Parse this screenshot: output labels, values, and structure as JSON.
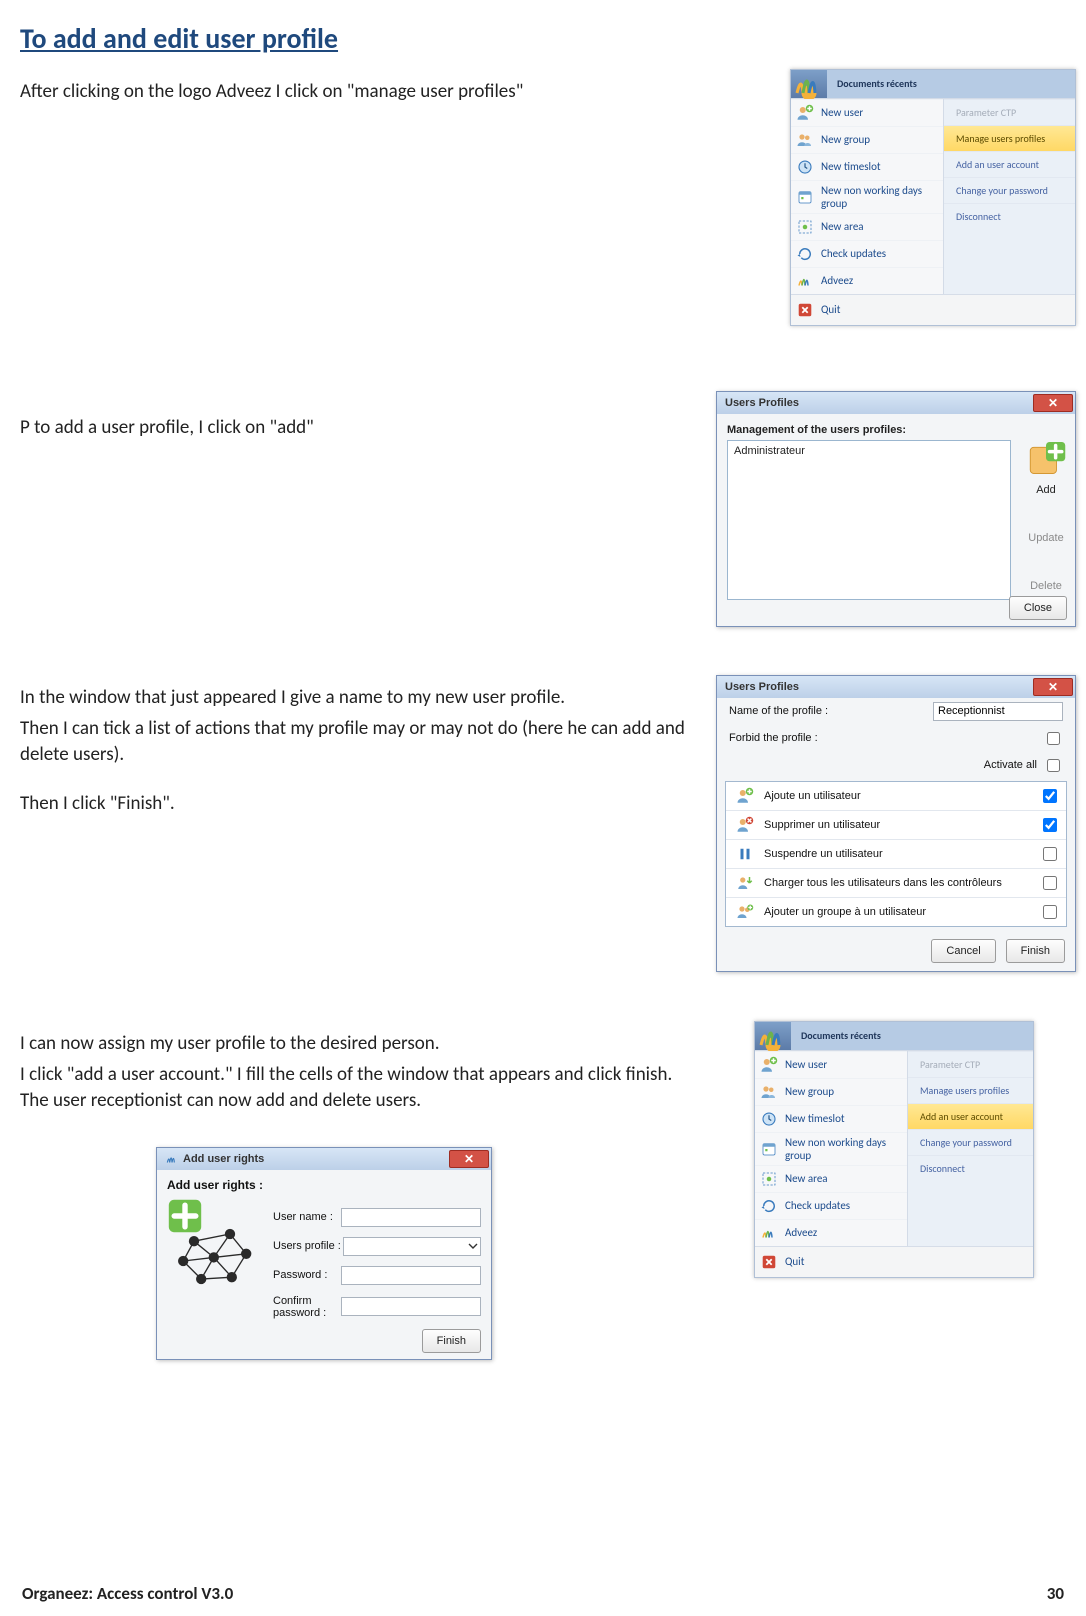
{
  "heading": "To add and edit user profile",
  "p1": "After clicking on the logo Adveez I click on \"manage user profiles\"",
  "p2": "P to add a user profile, I click on \"add\"",
  "p3": "In the window that just appeared I give a name to my new user profile.",
  "p4": "Then I can tick a list of actions that my profile may or may not do (here he can add and delete users).",
  "p5": "Then I click \"Finish\".",
  "p6": "I can now assign my user profile to the desired person.",
  "p7": "I click \"add a user account.\" I fill the cells of the window that appears and click finish. The user receptionist can now add and delete users.",
  "menu": {
    "doc_recent": "Documents récents",
    "items": [
      {
        "label": "New user",
        "icon": "user-plus"
      },
      {
        "label": "New group",
        "icon": "group"
      },
      {
        "label": "New timeslot",
        "icon": "clock"
      },
      {
        "label": "New non working days group",
        "icon": "calendar"
      },
      {
        "label": "New area",
        "icon": "area"
      },
      {
        "label": "Check updates",
        "icon": "refresh"
      },
      {
        "label": "Adveez",
        "icon": "bars"
      }
    ],
    "sub": [
      {
        "label": "Parameter CTP",
        "disabled": true,
        "hl": false
      },
      {
        "label": "Manage users profiles",
        "disabled": false,
        "hl": true
      },
      {
        "label": "Add an user account",
        "disabled": false,
        "hl": false
      },
      {
        "label": "Change your password",
        "disabled": false,
        "hl": false
      },
      {
        "label": "Disconnect",
        "disabled": false,
        "hl": false
      }
    ],
    "quit": "Quit"
  },
  "menu2": {
    "doc_recent": "Documents récents",
    "items": [
      {
        "label": "New user",
        "icon": "user-plus"
      },
      {
        "label": "New group",
        "icon": "group"
      },
      {
        "label": "New timeslot",
        "icon": "clock"
      },
      {
        "label": "New non working days group",
        "icon": "calendar"
      },
      {
        "label": "New area",
        "icon": "area"
      },
      {
        "label": "Check updates",
        "icon": "refresh"
      },
      {
        "label": "Adveez",
        "icon": "bars"
      }
    ],
    "sub": [
      {
        "label": "Parameter CTP",
        "disabled": true,
        "hl": false
      },
      {
        "label": "Manage users profiles",
        "disabled": false,
        "hl": false
      },
      {
        "label": "Add an user account",
        "disabled": false,
        "hl": true
      },
      {
        "label": "Change your password",
        "disabled": false,
        "hl": false
      },
      {
        "label": "Disconnect",
        "disabled": false,
        "hl": false
      }
    ],
    "quit": "Quit"
  },
  "up_window": {
    "title": "Users Profiles",
    "header": "Management of the users profiles:",
    "row0": "Administrateur",
    "add": "Add",
    "update": "Update",
    "delete": "Delete",
    "close": "Close"
  },
  "pe_window": {
    "title": "Users Profiles",
    "name_label": "Name of the profile :",
    "name_value": "Receptionnist",
    "forbid_label": "Forbid the profile :",
    "activate_all": "Activate all",
    "items": [
      {
        "label": "Ajoute un utilisateur",
        "checked": true,
        "icon": "user-plus"
      },
      {
        "label": "Supprimer un utilisateur",
        "checked": true,
        "icon": "user-x"
      },
      {
        "label": "Suspendre un utilisateur",
        "checked": false,
        "icon": "pause"
      },
      {
        "label": "Charger tous les utilisateurs dans les contrôleurs",
        "checked": false,
        "icon": "download"
      },
      {
        "label": "Ajouter un groupe à un utilisateur",
        "checked": false,
        "icon": "group-plus"
      }
    ],
    "cancel": "Cancel",
    "finish": "Finish"
  },
  "aur_window": {
    "title": "Add user rights",
    "header": "Add user rights :",
    "username_label": "User name :",
    "profile_label": "Users profile :",
    "password_label": "Password :",
    "confirm_label": "Confirm password :",
    "finish": "Finish"
  },
  "footer_left": "Organeez: Access control    V3.0",
  "footer_right": "30"
}
